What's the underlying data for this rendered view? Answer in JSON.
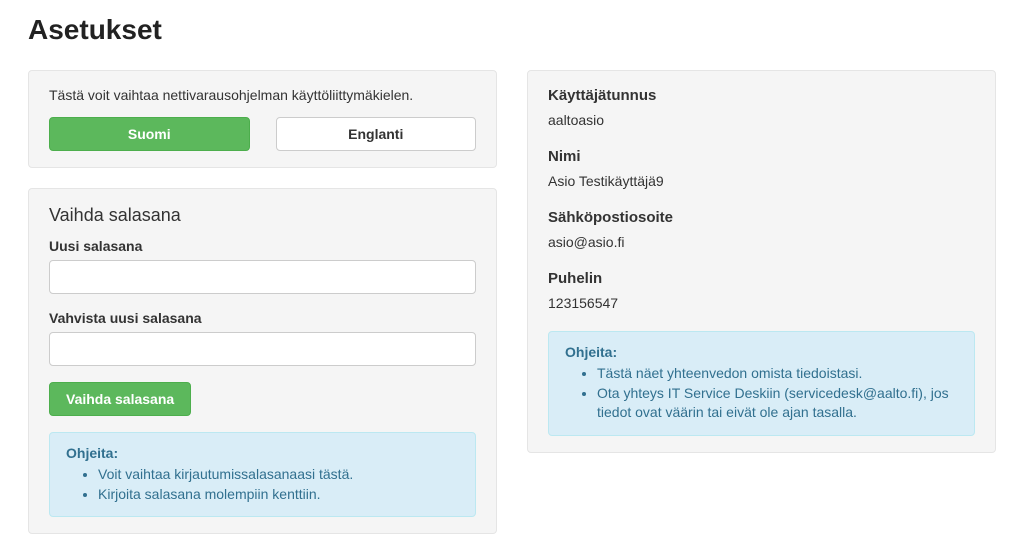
{
  "pageTitle": "Asetukset",
  "langPanel": {
    "note": "Tästä voit vaihtaa nettivarausohjelman käyttöliittymäkielen.",
    "btnFi": "Suomi",
    "btnEn": "Englanti"
  },
  "pwPanel": {
    "title": "Vaihda salasana",
    "newLabel": "Uusi salasana",
    "confirmLabel": "Vahvista uusi salasana",
    "submit": "Vaihda salasana",
    "helpTitle": "Ohjeita:",
    "help1": "Voit vaihtaa kirjautumissalasanaasi tästä.",
    "help2": "Kirjoita salasana molempiin kenttiin."
  },
  "userPanel": {
    "userLabel": "Käyttäjätunnus",
    "userValue": "aaltoasio",
    "nameLabel": "Nimi",
    "nameValue": "Asio Testikäyttäjä9",
    "emailLabel": "Sähköpostiosoite",
    "emailValue": "asio@asio.fi",
    "phoneLabel": "Puhelin",
    "phoneValue": "123156547",
    "helpTitle": "Ohjeita:",
    "help1": "Tästä näet yhteenvedon omista tiedoistasi.",
    "help2": "Ota yhteys IT Service Deskiin (servicedesk@aalto.fi), jos tiedot ovat väärin tai eivät ole ajan tasalla."
  }
}
